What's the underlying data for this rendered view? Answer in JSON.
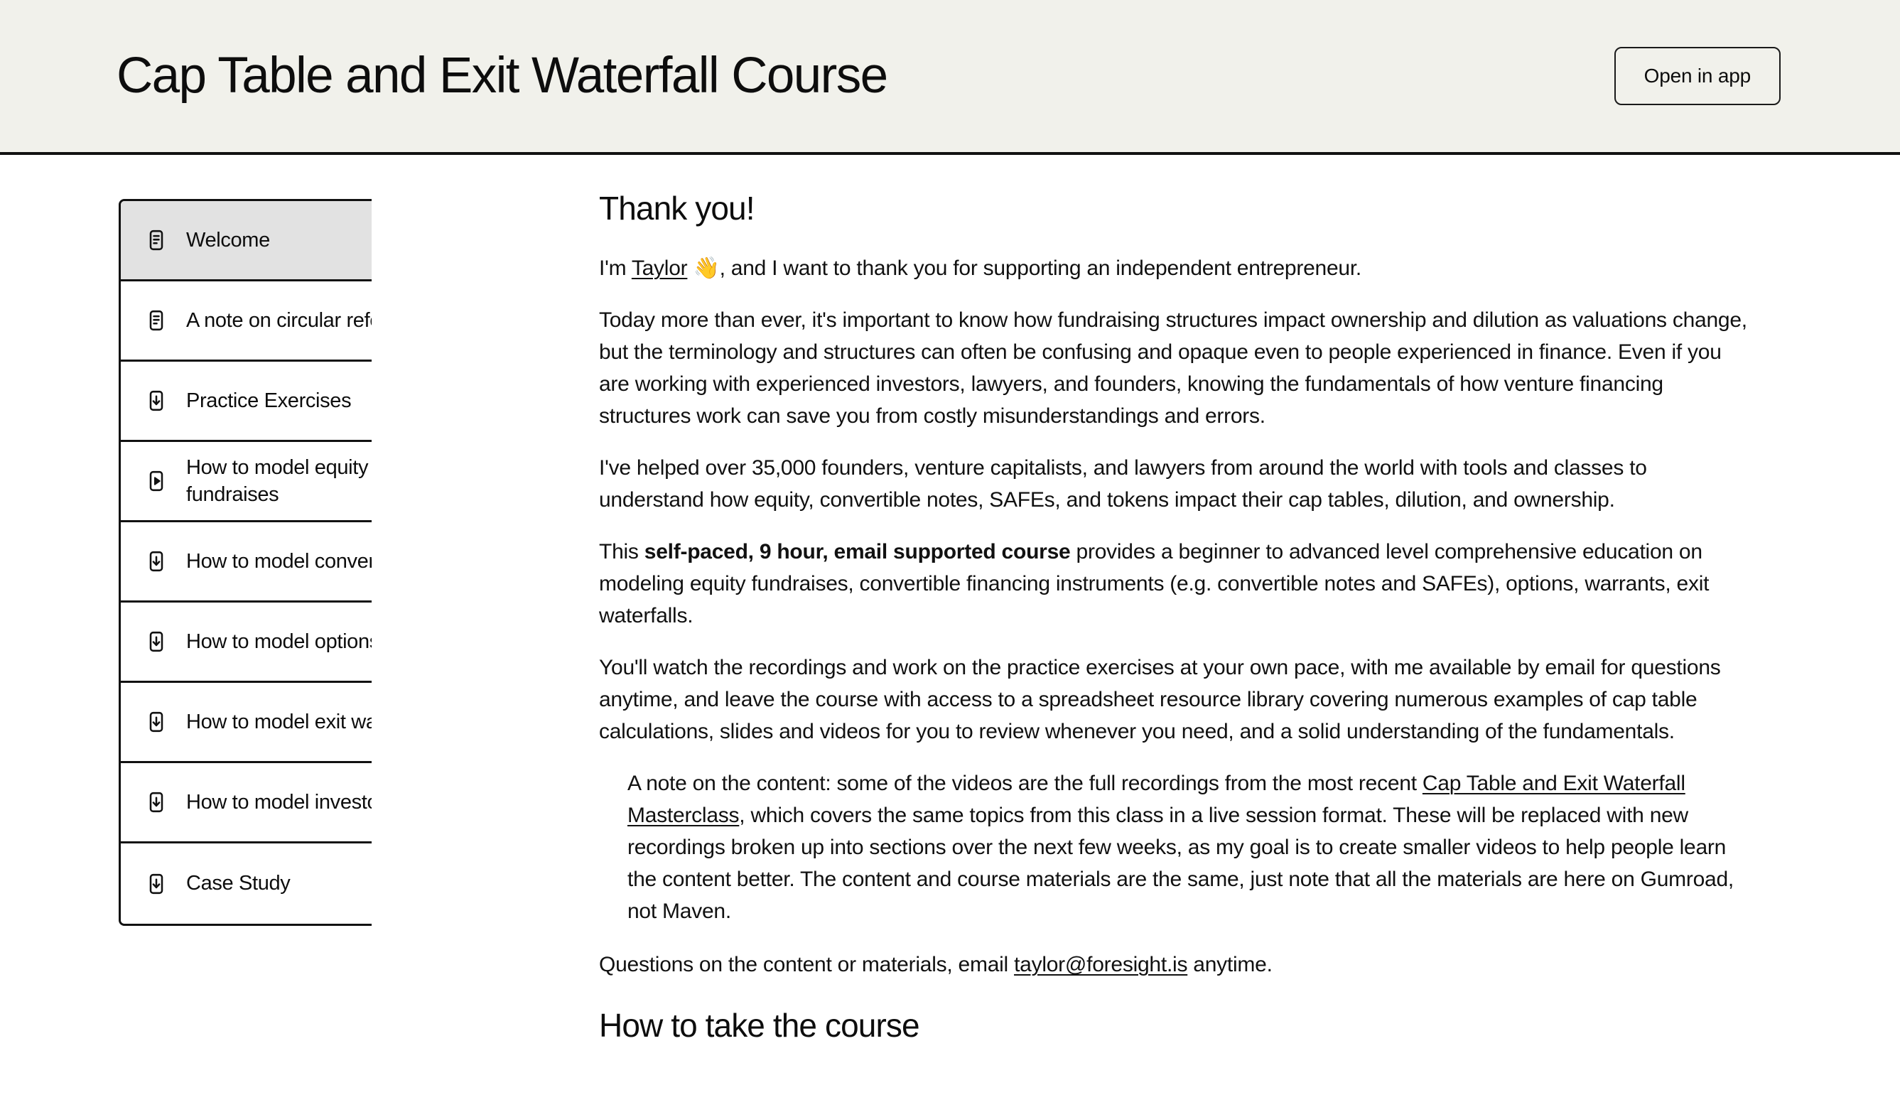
{
  "header": {
    "title": "Cap Table and Exit Waterfall Course",
    "open_in_app_label": "Open in app",
    "background_color": "#f1f1eb",
    "border_color": "#111111"
  },
  "sidebar": {
    "active_background_color": "#e2e2e2",
    "items": [
      {
        "label": "Welcome",
        "icon": "document-icon",
        "active": true
      },
      {
        "label": "A note on circular references",
        "icon": "document-icon",
        "active": false
      },
      {
        "label": "Practice Exercises",
        "icon": "download-icon",
        "active": false
      },
      {
        "label": "How to model equity fundraises",
        "icon": "play-icon",
        "active": false
      },
      {
        "label": "How to model convertibles",
        "icon": "download-icon",
        "active": false
      },
      {
        "label": "How to model options",
        "icon": "download-icon",
        "active": false
      },
      {
        "label": "How to model exit waterfalls",
        "icon": "download-icon",
        "active": false
      },
      {
        "label": "How to model investor returns",
        "icon": "download-icon",
        "active": false
      },
      {
        "label": "Case Study",
        "icon": "download-icon",
        "active": false
      }
    ]
  },
  "main": {
    "heading": "Thank you!",
    "intro": {
      "before_link": "I'm ",
      "link_text": "Taylor",
      "emoji": "👋",
      "after_link": ", and I want to thank you for supporting an independent entrepreneur."
    },
    "paragraph_today": "Today more than ever, it's important to know how fundraising structures impact ownership and dilution as valuations change, but the terminology and structures can often be confusing and opaque even to people experienced in finance. Even if you are working with experienced investors, lawyers, and founders, knowing the fundamentals of how venture financing structures work can save you from costly misunderstandings and errors.",
    "paragraph_helped": "I've helped over 35,000 founders, venture capitalists, and lawyers from around the world with tools and classes to understand how equity, convertible notes, SAFEs, and tokens impact their cap tables, dilution, and ownership.",
    "paragraph_course": {
      "before_bold": "This ",
      "bold_text": "self-paced, 9 hour, email supported course",
      "after_bold": " provides a beginner to advanced level comprehensive education on modeling equity fundraises, convertible financing instruments (e.g. convertible notes and SAFEs), options, warrants, exit waterfalls."
    },
    "paragraph_watch": "You'll watch the recordings and work on the practice exercises at your own pace, with me available by email for questions anytime, and leave the course with access to a spreadsheet resource library covering numerous examples of cap table calculations, slides and videos for you to review whenever you need, and a solid understanding of the fundamentals.",
    "note_block": {
      "before_link": "A note on the content: some of the videos are the full recordings from the most recent ",
      "link_text": "Cap Table and Exit Waterfall Masterclass",
      "after_link": ", which covers the same topics from this class in a live session format. These will be replaced with new recordings broken up into sections over the next few weeks, as my goal is to create smaller videos to help people learn the content better. The content and course materials are the same, just note that all the materials are here on Gumroad, not Maven."
    },
    "paragraph_questions": {
      "before_link": "Questions on the content or materials, email ",
      "link_text": "taylor@foresight.is",
      "after_link": " anytime."
    },
    "subsection_heading": "How to take the course"
  }
}
